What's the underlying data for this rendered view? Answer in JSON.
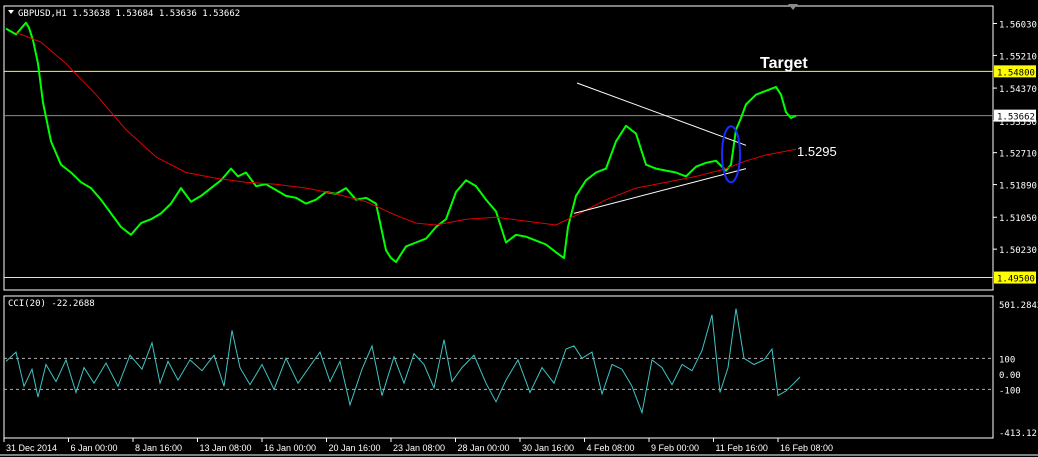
{
  "chart_data": {
    "type": "line",
    "title": "GBPUSD,H1  1.53638 1.53684 1.53636 1.53662",
    "main": {
      "ylim": [
        1.4918,
        1.5648
      ],
      "y_ticks": [
        "1.56030",
        "1.55210",
        "1.54370",
        "1.53530",
        "1.52710",
        "1.51890",
        "1.51050",
        "1.50230"
      ],
      "y_tick_values": [
        1.5603,
        1.5521,
        1.5437,
        1.5353,
        1.5271,
        1.5189,
        1.5105,
        1.5023
      ],
      "x_ticks": [
        "31 Dec 2014",
        "6 Jan 00:00",
        "8 Jan 16:00",
        "13 Jan 08:00",
        "16 Jan 00:00",
        "20 Jan 16:00",
        "23 Jan 08:00",
        "28 Jan 00:00",
        "30 Jan 16:00",
        "4 Feb 08:00",
        "9 Feb 00:00",
        "11 Feb 16:00",
        "16 Feb 08:00"
      ],
      "horizontal_levels": [
        {
          "label": "1.54800",
          "value": 1.548,
          "color": "#ffff00"
        },
        {
          "label": "1.49500",
          "value": 1.495,
          "color": "#ffff00"
        },
        {
          "label": "1.53662",
          "value": 1.53662,
          "color": "#8c8c8c"
        }
      ],
      "annotations": [
        {
          "text": "Target"
        },
        {
          "text": "1.5295"
        }
      ],
      "series": [
        {
          "color": "#00ff00",
          "x": [
            0,
            10,
            20,
            23,
            27,
            32,
            37,
            45,
            55,
            65,
            75,
            85,
            95,
            105,
            115,
            125,
            135,
            145,
            155,
            165,
            175,
            185,
            195,
            205,
            215,
            225,
            232,
            240,
            250,
            260,
            270,
            280,
            290,
            300,
            310,
            320,
            330,
            340,
            350,
            360,
            370,
            375,
            380,
            385,
            390,
            395,
            400,
            410,
            420,
            430,
            440,
            450,
            460,
            470,
            480,
            490,
            500,
            510,
            520,
            530,
            540,
            550,
            558,
            562,
            570,
            580,
            590,
            600,
            610,
            620,
            630,
            640,
            650,
            660,
            670,
            680,
            690,
            700,
            710,
            720,
            725,
            730,
            735,
            740,
            750,
            760,
            770,
            775,
            780,
            785,
            790
          ],
          "y": [
            1.559,
            1.5575,
            1.5605,
            1.5592,
            1.556,
            1.55,
            1.54,
            1.53,
            1.524,
            1.522,
            1.5195,
            1.518,
            1.515,
            1.5115,
            1.508,
            1.506,
            1.509,
            1.51,
            1.5115,
            1.514,
            1.518,
            1.5145,
            1.516,
            1.518,
            1.52,
            1.523,
            1.521,
            1.522,
            1.5185,
            1.519,
            1.5175,
            1.516,
            1.5155,
            1.514,
            1.515,
            1.517,
            1.5165,
            1.518,
            1.515,
            1.5155,
            1.514,
            1.508,
            1.502,
            1.5,
            1.499,
            1.501,
            1.503,
            1.504,
            1.505,
            1.508,
            1.51,
            1.517,
            1.52,
            1.5185,
            1.515,
            1.512,
            1.504,
            1.506,
            1.5055,
            1.5045,
            1.5035,
            1.5015,
            1.5,
            1.508,
            1.516,
            1.52,
            1.522,
            1.523,
            1.53,
            1.534,
            1.532,
            1.524,
            1.523,
            1.5225,
            1.522,
            1.521,
            1.5235,
            1.5245,
            1.525,
            1.5225,
            1.524,
            1.533,
            1.536,
            1.5395,
            1.542,
            1.543,
            1.544,
            1.542,
            1.5375,
            1.536,
            1.5366
          ]
        },
        {
          "color": "#e00000",
          "x": [
            10,
            35,
            60,
            90,
            120,
            150,
            180,
            210,
            240,
            270,
            300,
            330,
            360,
            390,
            410,
            430,
            460,
            490,
            520,
            550,
            570,
            600,
            630,
            660,
            690,
            720,
            740,
            760,
            790
          ],
          "y": [
            1.558,
            1.5555,
            1.55,
            1.542,
            1.533,
            1.526,
            1.522,
            1.5205,
            1.5195,
            1.519,
            1.518,
            1.5165,
            1.5145,
            1.511,
            1.509,
            1.5085,
            1.51,
            1.5105,
            1.5095,
            1.5085,
            1.511,
            1.515,
            1.518,
            1.5195,
            1.521,
            1.523,
            1.525,
            1.5265,
            1.528
          ]
        },
        {
          "color": "#ffffff",
          "x": [
            571,
            740
          ],
          "y": [
            1.545,
            1.529
          ]
        },
        {
          "color": "#ffffff",
          "x": [
            568,
            740
          ],
          "y": [
            1.5115,
            1.523
          ]
        }
      ]
    },
    "cci": {
      "label": "CCI(20) -22.2688",
      "ylim": [
        -413.1211,
        501.2842
      ],
      "y_ticks": [
        "501.2842",
        "100",
        "0.00",
        "-100",
        "-413.1211"
      ],
      "y_tick_values": [
        501.2842,
        100,
        0,
        -100,
        -413.1211
      ],
      "levels": [
        100,
        -100
      ],
      "series": [
        {
          "color": "#3fc4c4",
          "x": [
            0,
            10,
            18,
            26,
            32,
            40,
            50,
            60,
            70,
            78,
            88,
            100,
            112,
            124,
            136,
            146,
            154,
            162,
            172,
            184,
            196,
            208,
            218,
            226,
            234,
            244,
            256,
            268,
            280,
            292,
            304,
            314,
            324,
            334,
            344,
            356,
            366,
            376,
            388,
            398,
            408,
            418,
            428,
            438,
            446,
            456,
            468,
            480,
            490,
            500,
            512,
            524,
            536,
            548,
            560,
            568,
            576,
            586,
            596,
            606,
            616,
            626,
            636,
            646,
            656,
            666,
            676,
            686,
            696,
            706,
            714,
            722,
            730,
            738,
            748,
            758,
            766,
            772,
            780,
            788,
            794
          ],
          "y": [
            80,
            140,
            -80,
            30,
            -150,
            60,
            -50,
            90,
            -120,
            40,
            -60,
            70,
            -80,
            120,
            30,
            200,
            -60,
            80,
            -40,
            90,
            20,
            120,
            -80,
            280,
            40,
            -70,
            60,
            -100,
            100,
            -60,
            50,
            140,
            -50,
            80,
            -200,
            30,
            180,
            -140,
            110,
            -60,
            130,
            60,
            -90,
            220,
            -50,
            40,
            120,
            -60,
            -180,
            -40,
            90,
            -120,
            40,
            -60,
            160,
            180,
            100,
            140,
            -130,
            60,
            30,
            -80,
            -250,
            90,
            40,
            -70,
            60,
            20,
            150,
            380,
            -120,
            40,
            420,
            100,
            60,
            90,
            160,
            -140,
            -110,
            -60,
            -20
          ]
        }
      ]
    }
  }
}
